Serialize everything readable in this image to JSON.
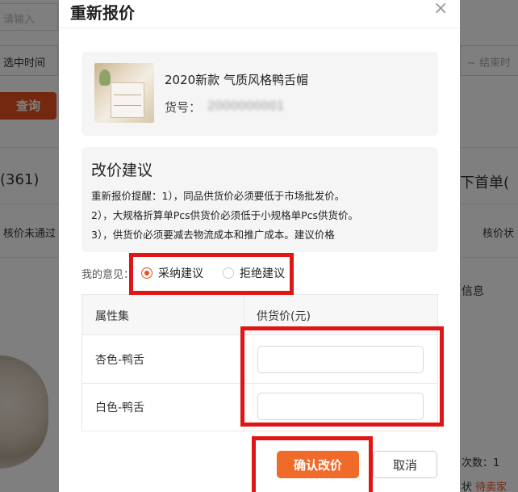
{
  "background": {
    "search_placeholder": "请输入",
    "time_select": "选中时间",
    "end_time_placeholder": "~ 结束时",
    "query_button": "查询",
    "tab_count": "(361)",
    "right_tab": "下首单(",
    "filter_left": "核价未通过",
    "filter_right": "核价状",
    "info_label": "信息",
    "times_label": "次数：1",
    "status_label": "状",
    "status_value": "待卖家"
  },
  "dialog": {
    "title": "重新报价",
    "close_icon": "×",
    "product": {
      "name": "2020新款 气质风格鸭舌帽",
      "sku_label": "货号：",
      "sku_value": "2000000001"
    },
    "suggestion": {
      "title": "改价建议",
      "lines": [
        "重新报价提醒：1），同品供货价必须要低于市场批发价。",
        "2），大规格折算单Pcs供货价必须低于小规格单Pcs供货价。",
        "3），供货价必须要减去物流成本和推广成本。建议价格"
      ]
    },
    "opinion": {
      "label": "我的意见：",
      "accept": "采纳建议",
      "reject": "拒绝建议",
      "selected": "accept"
    },
    "table": {
      "headers": [
        "属性集",
        "供货价(元)"
      ],
      "rows": [
        {
          "attribute": "杏色-鸭舌",
          "price": ""
        },
        {
          "attribute": "白色-鸭舌",
          "price": ""
        }
      ]
    },
    "confirm_button": "确认改价",
    "cancel_button": "取消"
  },
  "colors": {
    "accent": "#f06a2a",
    "highlight": "#e01616",
    "overlay": "rgba(0,0,0,0.5)"
  }
}
